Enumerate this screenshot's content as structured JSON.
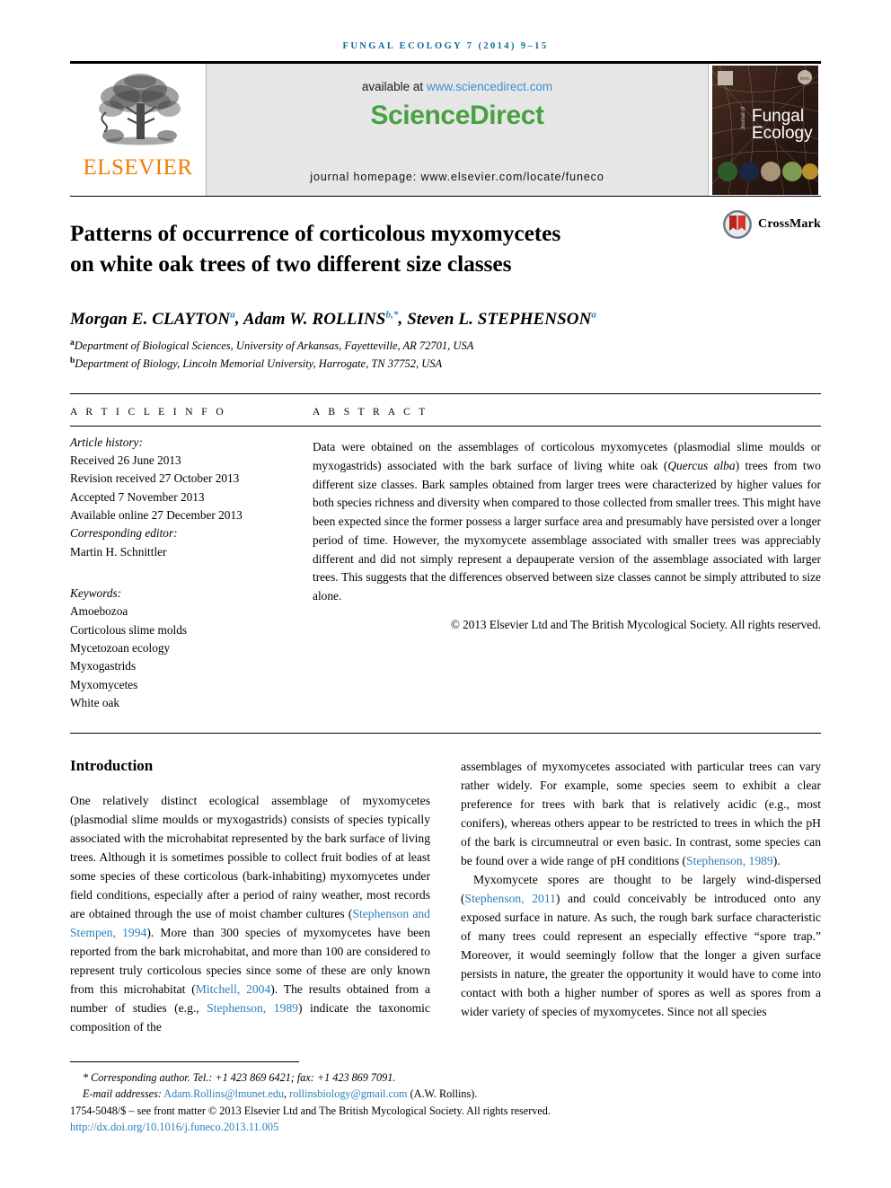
{
  "running_head": "FUNGAL ECOLOGY 7 (2014) 9–15",
  "masthead": {
    "publisher_name": "ELSEVIER",
    "publisher_logo_icon": "elsevier-tree-icon",
    "available_at_prefix": "available at ",
    "available_at_link": "www.sciencedirect.com",
    "sciencedirect_logo": "ScienceDirect",
    "journal_homepage": "journal homepage: www.elsevier.com/locate/funeco",
    "cover": {
      "journal_name_line1": "Fungal",
      "journal_name_line2": "Ecology",
      "vertical_text": "Journal of",
      "publisher_badge_icon": "elsevier-badge-icon",
      "society_badge_icon": "bms-badge-icon"
    }
  },
  "article": {
    "title_line1": "Patterns of occurrence of corticolous myxomycetes",
    "title_line2": "on white oak trees of two different size classes",
    "crossmark_label": "CrossMark",
    "crossmark_icon": "crossmark-icon",
    "authors": [
      {
        "name": "Morgan E. CLAYTON",
        "sup": "a",
        "star": ""
      },
      {
        "name": "Adam W. ROLLINS",
        "sup": "b",
        "star": ",*"
      },
      {
        "name": "Steven L. STEPHENSON",
        "sup": "a",
        "star": ""
      }
    ],
    "affiliations": [
      {
        "marker": "a",
        "text": "Department of Biological Sciences, University of Arkansas, Fayetteville, AR 72701, USA"
      },
      {
        "marker": "b",
        "text": "Department of Biology, Lincoln Memorial University, Harrogate, TN 37752, USA"
      }
    ]
  },
  "article_info": {
    "heading": "A R T I C L E   I N F O",
    "history_label": "Article history:",
    "history": [
      "Received 26 June 2013",
      "Revision received 27 October 2013",
      "Accepted 7 November 2013",
      "Available online 27 December 2013"
    ],
    "corresponding_editor_label": "Corresponding editor:",
    "corresponding_editor_name": "Martin H. Schnittler",
    "keywords_label": "Keywords:",
    "keywords": [
      "Amoebozoa",
      "Corticolous slime molds",
      "Mycetozoan ecology",
      "Myxogastrids",
      "Myxomycetes",
      "White oak"
    ]
  },
  "abstract": {
    "heading": "A B S T R A C T",
    "paragraph_part1": "Data were obtained on the assemblages of corticolous myxomycetes (plasmodial slime moulds or myxogastrids) associated with the bark surface of living white oak (",
    "species_italic": "Quercus alba",
    "paragraph_part2": ") trees from two different size classes. Bark samples obtained from larger trees were characterized by higher values for both species richness and diversity when compared to those collected from smaller trees. This might have been expected since the former possess a larger surface area and presumably have persisted over a longer period of time. However, the myxomycete assemblage associated with smaller trees was appreciably different and did not simply represent a depauperate version of the assemblage associated with larger trees. This suggests that the differences observed between size classes cannot be simply attributed to size alone.",
    "copyright": "© 2013 Elsevier Ltd and The British Mycological Society. All rights reserved."
  },
  "body": {
    "section_heading": "Introduction",
    "left_column": {
      "p1_a": "One relatively distinct ecological assemblage of myxomycetes (plasmodial slime moulds or myxogastrids) consists of species typically associated with the microhabitat represented by the bark surface of living trees. Although it is sometimes possible to collect fruit bodies of at least some species of these corticolous (bark-inhabiting) myxomycetes under field conditions, especially after a period of rainy weather, most records are obtained through the use of moist chamber cultures (",
      "cite1": "Stephenson and Stempen, 1994",
      "p1_b": "). More than 300 species of myxomycetes have been reported from the bark microhabitat, and more than 100 are considered to represent truly corticolous species since some of these are only known from this microhabitat (",
      "cite2": "Mitchell, 2004",
      "p1_c": "). The results obtained from a number of studies (e.g., ",
      "cite3": "Stephenson, 1989",
      "p1_d": ") indicate the taxonomic composition of the"
    },
    "right_column": {
      "p1_cont": "assemblages of myxomycetes associated with particular trees can vary rather widely. For example, some species seem to exhibit a clear preference for trees with bark that is relatively acidic (e.g., most conifers), whereas others appear to be restricted to trees in which the pH of the bark is circumneutral or even basic. In contrast, some species can be found over a wide range of pH conditions (",
      "cite1": "Stephenson, 1989",
      "p1_end": ").",
      "p2_a": "Myxomycete spores are thought to be largely wind-dispersed (",
      "cite2": "Stephenson, 2011",
      "p2_b": ") and could conceivably be introduced onto any exposed surface in nature. As such, the rough bark surface characteristic of many trees could represent an especially effective “spore trap.” Moreover, it would seemingly follow that the longer a given surface persists in nature, the greater the opportunity it would have to come into contact with both a higher number of spores as well as spores from a wider variety of species of myxomycetes. Since not all species"
    }
  },
  "footer": {
    "corresponding_marker": "*",
    "corresponding_label": "Corresponding author.",
    "corresponding_contact": " Tel.: +1 423 869 6421; fax: +1 423 869 7091.",
    "email_label": "E-mail addresses:",
    "email1": "Adam.Rollins@lmunet.edu",
    "email_sep": ", ",
    "email2": "rollinsbiology@gmail.com",
    "email_suffix": " (A.W. Rollins).",
    "front_matter": "1754-5048/$ – see front matter © 2013 Elsevier Ltd and The British Mycological Society. All rights reserved.",
    "doi": "http://dx.doi.org/10.1016/j.funeco.2013.11.005"
  },
  "colors": {
    "link_blue": "#2a7fbd",
    "running_head_blue": "#0a6b96",
    "elsevier_orange": "#f07d00",
    "sciencedirect_green": "#47a23f",
    "masthead_grey": "#e6e6e6"
  }
}
